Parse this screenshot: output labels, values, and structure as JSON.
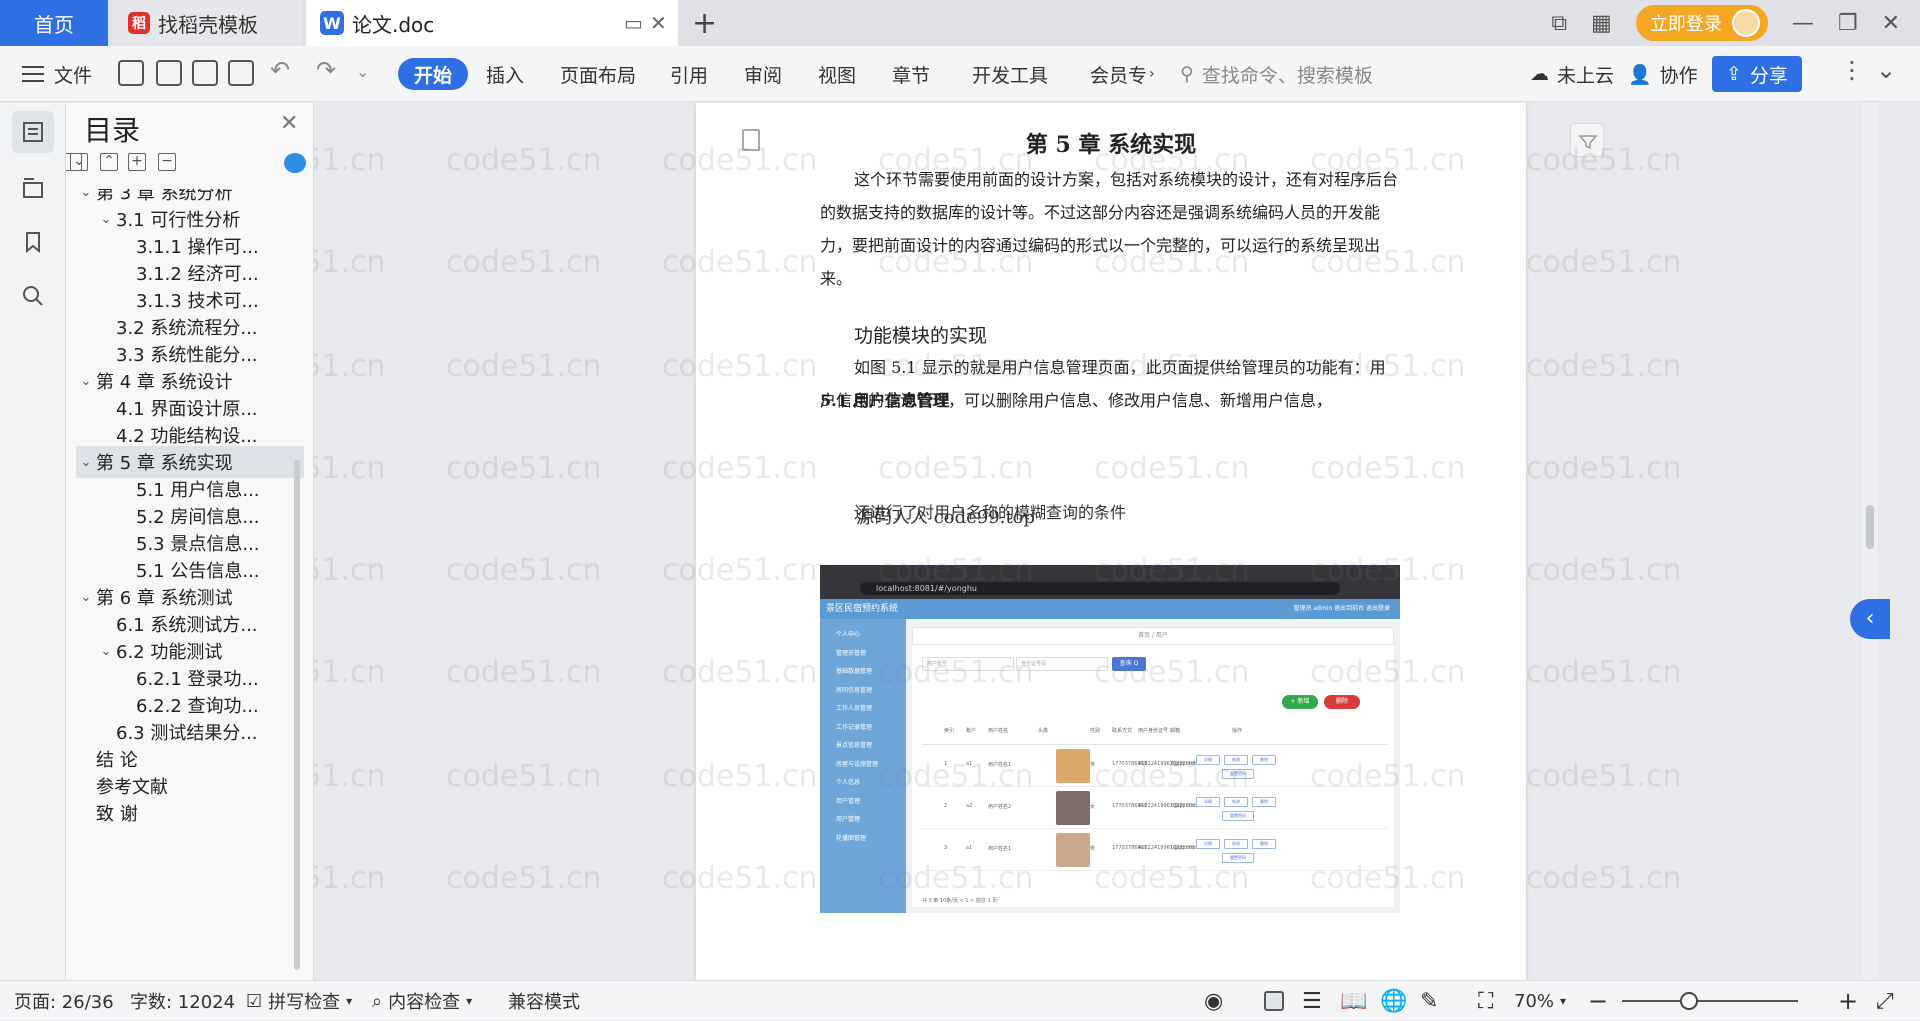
{
  "tabs": {
    "home": "首页",
    "template": "找稻壳模板",
    "doc": "论文.doc",
    "template_logo": "稻",
    "doc_logo": "W"
  },
  "titlebar": {
    "login": "立即登录"
  },
  "ribbon": {
    "file": "文件",
    "start": "开始",
    "insert": "插入",
    "layout": "页面布局",
    "reference": "引用",
    "review": "审阅",
    "view": "视图",
    "chapter": "章节",
    "devtools": "开发工具",
    "member": "会员专",
    "search_placeholder": "查找命令、搜索模板",
    "cloud": "未上云",
    "collab": "协作",
    "share": "分享"
  },
  "toc": {
    "title": "目录",
    "items": [
      {
        "label": "第 3 章  系统分析",
        "level": 1,
        "arrow": "⌄"
      },
      {
        "label": "3.1 可行性分析",
        "level": 2,
        "arrow": "⌄"
      },
      {
        "label": "3.1.1 操作可...",
        "level": 3,
        "arrow": ""
      },
      {
        "label": "3.1.2 经济可...",
        "level": 3,
        "arrow": ""
      },
      {
        "label": "3.1.3 技术可...",
        "level": 3,
        "arrow": ""
      },
      {
        "label": "3.2 系统流程分...",
        "level": 2,
        "arrow": ""
      },
      {
        "label": "3.3 系统性能分...",
        "level": 2,
        "arrow": ""
      },
      {
        "label": "第 4 章  系统设计",
        "level": 1,
        "arrow": "⌄"
      },
      {
        "label": "4.1 界面设计原...",
        "level": 2,
        "arrow": ""
      },
      {
        "label": "4.2 功能结构设...",
        "level": 2,
        "arrow": ""
      },
      {
        "label": "第 5 章  系统实现",
        "level": 1,
        "arrow": "⌄",
        "selected": true
      },
      {
        "label": "5.1 用户信息...",
        "level": 3,
        "arrow": ""
      },
      {
        "label": "5.2  房间信息...",
        "level": 3,
        "arrow": ""
      },
      {
        "label": "5.3 景点信息...",
        "level": 3,
        "arrow": ""
      },
      {
        "label": "5.1 公告信息...",
        "level": 3,
        "arrow": ""
      },
      {
        "label": "第 6 章  系统测试",
        "level": 1,
        "arrow": "⌄"
      },
      {
        "label": "6.1  系统测试方...",
        "level": 2,
        "arrow": ""
      },
      {
        "label": "6.2  功能测试",
        "level": 2,
        "arrow": "⌄"
      },
      {
        "label": "6.2.1  登录功...",
        "level": 3,
        "arrow": ""
      },
      {
        "label": "6.2.2  查询功...",
        "level": 3,
        "arrow": ""
      },
      {
        "label": "6.3  测试结果分...",
        "level": 2,
        "arrow": ""
      },
      {
        "label": "结   论",
        "level": 1,
        "arrow": ""
      },
      {
        "label": "参考文献",
        "level": 1,
        "arrow": ""
      },
      {
        "label": "致   谢",
        "level": 1,
        "arrow": ""
      }
    ]
  },
  "document": {
    "chapter_title": "第 5 章  系统实现",
    "para1": "这个环节需要使用前面的设计方案，包括对系统模块的设计，还有对程序后台的数据支持的数据库的设计等。不过这部分内容还是强调系统编码人员的开发能力，要把前面设计的内容通过编码的形式以一个完整的，可以运行的系统呈现出来。",
    "func_heading": "功能模块的实现",
    "section_heading": "5.1 用户信息管理",
    "para2": "如图 5.1 显示的就是用户信息管理页面，此页面提供给管理员的功能有：用户信息的查询管理，可以删除用户信息、修改用户信息、新增用户信息，",
    "condition_text": "还进行了对用户名称的模糊查询的条件",
    "overlay_text": "源码人人 code99.top",
    "watermark": "code51.cn"
  },
  "figure": {
    "url": "localhost:8081/#/yonghu",
    "app_title": "景区民宿预约系统",
    "header_right": "管理员 admin    退出到前台    退出登录",
    "breadcrumb": "首页 / 用户",
    "input1": "用户账号",
    "input2": "身份证号码",
    "search": "查询 Q",
    "add": "+ 新增",
    "delete": "删除",
    "side_items": [
      "个人中心",
      "管理员管理",
      "基础数据管理",
      "房间信息管理",
      "工作人员管理",
      "工作记录管理",
      "景点信息管理",
      "房屋与设施管理",
      "个人信息",
      "用户管理",
      "用户管理",
      "轮播图管理"
    ],
    "columns": [
      "索引",
      "账户",
      "用户姓名",
      "头像",
      "性别",
      "联系方式",
      "用户身份证号",
      "邮箱",
      "操作"
    ],
    "rows": [
      {
        "idx": "1",
        "account": "a1",
        "name": "用户姓名1",
        "gender": "男",
        "phone": "17703786903",
        "idcard": "410224199610232003",
        "email": "3@qq.com"
      },
      {
        "idx": "2",
        "account": "a2",
        "name": "用户姓名2",
        "gender": "女",
        "phone": "17703786902",
        "idcard": "410224199610232002",
        "email": "2@qq.com"
      },
      {
        "idx": "3",
        "account": "a1",
        "name": "用户姓名1",
        "gender": "男",
        "phone": "17703786901",
        "idcard": "410224199610232001",
        "email": "1@qq.com"
      }
    ],
    "op_labels": [
      "详情",
      "修改",
      "删除",
      "重置密码"
    ],
    "pager": "共 3 条    10条/页     <  1  >   前往   1   页"
  },
  "status": {
    "page": "页面: 26/36",
    "words": "字数: 12024",
    "spell": "拼写检查",
    "content_check": "内容检查",
    "compat": "兼容模式",
    "zoom": "70%"
  },
  "colors": {
    "accent": "#2f6fe4",
    "login": "#f5a623"
  }
}
